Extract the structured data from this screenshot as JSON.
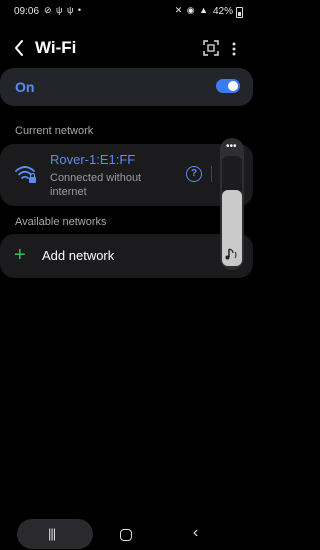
{
  "status_bar": {
    "time": "09:06",
    "left_icons": "⊘ ψ ψ •",
    "right_icons": "✕ ◉ ▲",
    "battery": "42%"
  },
  "app_bar": {
    "title": "Wi-Fi"
  },
  "wifi_toggle": {
    "label": "On",
    "state": "on"
  },
  "sections": {
    "current": "Current network",
    "available": "Available networks"
  },
  "current_network": {
    "name": "Rover-1:E1:FF",
    "status": "Connected without internet",
    "info_glyph": "?"
  },
  "add_network": {
    "plus": "+",
    "label": "Add network"
  },
  "side_panel": {
    "dots": "•••"
  },
  "nav": {
    "recents": "|||",
    "back": "‹"
  },
  "colors": {
    "accent": "#5b8def",
    "toggle": "#3d7cf0",
    "add": "#3fbf5a"
  }
}
